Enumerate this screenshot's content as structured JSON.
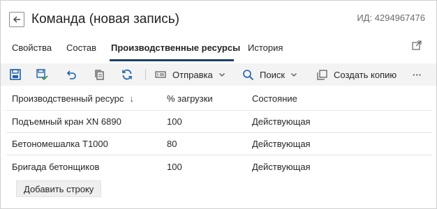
{
  "header": {
    "title": "Команда (новая запись)",
    "record_id": "ИД: 4294967476"
  },
  "tabs": [
    {
      "label": "Свойства",
      "active": false
    },
    {
      "label": "Состав",
      "active": false
    },
    {
      "label": "Производственные ресурсы",
      "active": true
    },
    {
      "label": "История",
      "active": false
    }
  ],
  "toolbar": {
    "send_label": "Отправка",
    "search_label": "Поиск",
    "copy_label": "Создать копию",
    "more_label": "···",
    "accent_color": "#1b5fa8"
  },
  "grid": {
    "columns": [
      "Производственный ресурс",
      "% загрузки",
      "Состояние"
    ],
    "sort_indicator": "↓",
    "rows": [
      {
        "resource": "Подъемный кран XN 6890",
        "load": "100",
        "state": "Действующая"
      },
      {
        "resource": "Бетономешалка T1000",
        "load": "80",
        "state": "Действующая"
      },
      {
        "resource": "Бригада бетонщиков",
        "load": "100",
        "state": "Действующая"
      }
    ]
  },
  "add_row_label": "Добавить строку"
}
